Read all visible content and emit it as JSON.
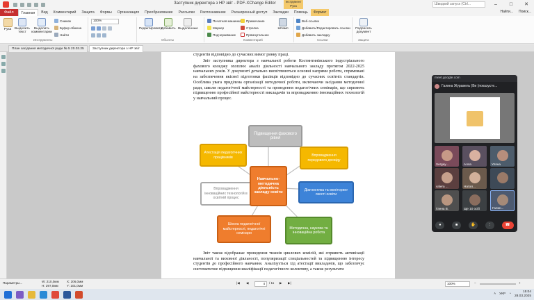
{
  "window": {
    "title": "Заступник директора з НР звіт - PDF-XChange Editor",
    "context_tab_title": "Інструмент Рука",
    "search_placeholder": "Швидкий запуск (Ctrl...",
    "controls": {
      "find": "Найти...",
      "search": "Поиск..."
    }
  },
  "menu": {
    "file": "Файл",
    "items": [
      "Главная",
      "Вид",
      "Комментарий",
      "Защита",
      "Формы",
      "Организация",
      "Преобразование",
      "Рассылки",
      "Распознавание",
      "Расширенный доступ",
      "Закладки",
      "Помощь",
      "Формат"
    ],
    "active": "Главная"
  },
  "ribbon": {
    "hand": "Рука",
    "select_text": "Выделить текст",
    "select_comments": "Выделить комментарии",
    "snapshot": "Снимок",
    "clipboard": "Буфер обмена",
    "find": "Найти",
    "zoom": "100%",
    "edit": "Редактировать",
    "add": "Добавить",
    "select": "Выделенные",
    "typewriter": "Печатная машинка",
    "marker": "Маркер",
    "underline": "Подчеркивание",
    "note": "Примечание",
    "strikeout": "Стрелка",
    "rectangle": "Прямоугольник",
    "stamp": "Штамп",
    "weblinks": "Веб-ссылки",
    "add_edit_links": "Добавить/Редактировать ссылки",
    "add_bookmark": "Добавить закладку",
    "sign": "Подписать документ",
    "groups": {
      "tools": "Инструменты",
      "objects": "Объекты",
      "comments": "Комментарий",
      "links": "Ссылки",
      "protect": "Защита"
    }
  },
  "doc_tabs": [
    {
      "label": "План засідання методичної ради № 5 20.03.25"
    },
    {
      "label": "Заступник директора з НР звіт"
    }
  ],
  "document": {
    "line0": "студентів відповідно до сучасних вимог ринку праці.",
    "para1": "Звіт заступника директора з навчальної роботи Костянтинівського індустріального фахового коледжу охоплює аналіз діяльності навчального закладу протягом 2022-2025 навчальних років. У документі детально висвітлюються основні напрями роботи, спрямовані на забезпечення якісної підготовки фахівців відповідно до сучасних освітніх стандартів. Особлива увага приділена організації методичної роботи, включаючи засідання методичної ради, школи педагогічної майстерності та проведення педагогічних семінарів, що сприяють підвищенню професійної майстерності викладачів та впровадженню інноваційних технологій у навчальний процес.",
    "para2": "Звіт також відображає проведення тижнів циклових комісій, які сприяють активізації навчальної та виховної діяльності, популяризації спеціальностей та підвищенню інтересу студентів до професійного навчання. Аналізується хід атестації викладачів, що забезпечує систематичне підвищення кваліфікації педагогічного колективу, а також результати",
    "diagram": {
      "center": "Навчально-методична діяльність закладу освіти",
      "top": "Підвищення фахового рівня",
      "right_top": "Впровадження передового досвіду",
      "right": "Діагностика та моніторинг якості освіти",
      "bottom_right": "Методична, наукова та інноваційна робота",
      "bottom_left": "Школа педагогічної майстерності, педагогічні семінари",
      "left": "Впровадження інноваційних технологій в освітній процес",
      "left_top": "Атестація педагогічних працівників"
    }
  },
  "status": {
    "params": "Параметры...",
    "w": "W: 210,0мм",
    "h": "H: 297,0мм",
    "x": "X: 206,0мм",
    "y": "Y: 101,0мм",
    "page": "4",
    "pages": "/ 11",
    "zoom": "100%"
  },
  "taskbar": {
    "time": "15:04",
    "date": "28.03.2025",
    "lang": "УКР"
  },
  "meet": {
    "url": "meet.google.com",
    "title": "Галина Журавель (Ви (показуєте...",
    "participants": [
      {
        "label": "Sergey..."
      },
      {
        "label": "Алла"
      },
      {
        "label": "Уляна"
      },
      {
        "label": "valera ..."
      },
      {
        "label": "Натал..."
      },
      {
        "label": "Ганна В."
      },
      {
        "label": "Ще 10 осіб"
      },
      {
        "label": "Галин..."
      }
    ]
  },
  "colors": {
    "file_tab": "#c62f2f",
    "context_tab": "#f4c96b",
    "node_top": "#bfbfbf",
    "node_yellow": "#f5b800",
    "node_blue": "#3d83d8",
    "node_green": "#72ae42",
    "node_orange": "#ef7d2d",
    "center": "#ef7d2d"
  }
}
